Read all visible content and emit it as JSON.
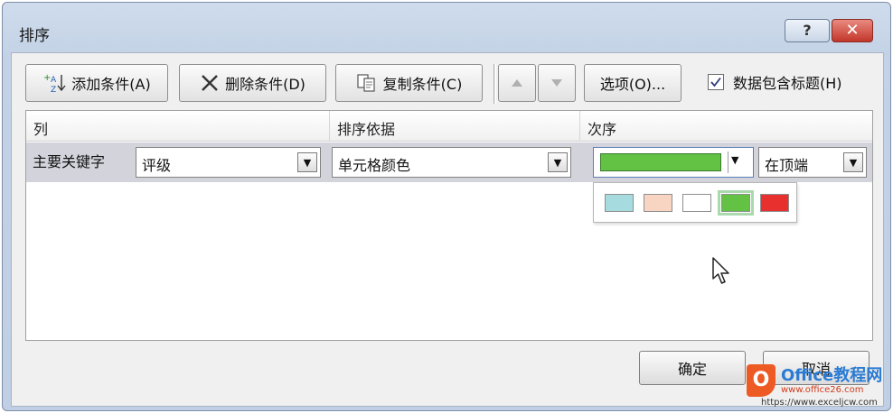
{
  "window": {
    "title": "排序",
    "help_label": "?",
    "close_label": "✕"
  },
  "toolbar": {
    "add_label": "添加条件(A)",
    "delete_label": "删除条件(D)",
    "copy_label": "复制条件(C)",
    "move_up_icon": "triangle-up-icon",
    "move_down_icon": "triangle-down-icon",
    "options_label": "选项(O)...",
    "header_checkbox_label": "数据包含标题(H)",
    "header_checkbox_checked": true
  },
  "grid": {
    "headers": [
      "列",
      "排序依据",
      "次序"
    ],
    "row": {
      "label": "主要关键字",
      "column_value": "评级",
      "sort_on_value": "单元格颜色",
      "order_color": "#63c144",
      "order_position": "在顶端"
    }
  },
  "palette": {
    "colors": [
      "#a6dcdf",
      "#f8d5c3",
      "#ffffff",
      "#63c144",
      "#e8302e"
    ],
    "selected_index": 3
  },
  "footer": {
    "ok_label": "确定",
    "cancel_label": "取消"
  },
  "watermark": {
    "logo_letter": "O",
    "title": "Office教程网",
    "url1": "www.office26.com",
    "url2": "https://www.exceljcw.com"
  }
}
